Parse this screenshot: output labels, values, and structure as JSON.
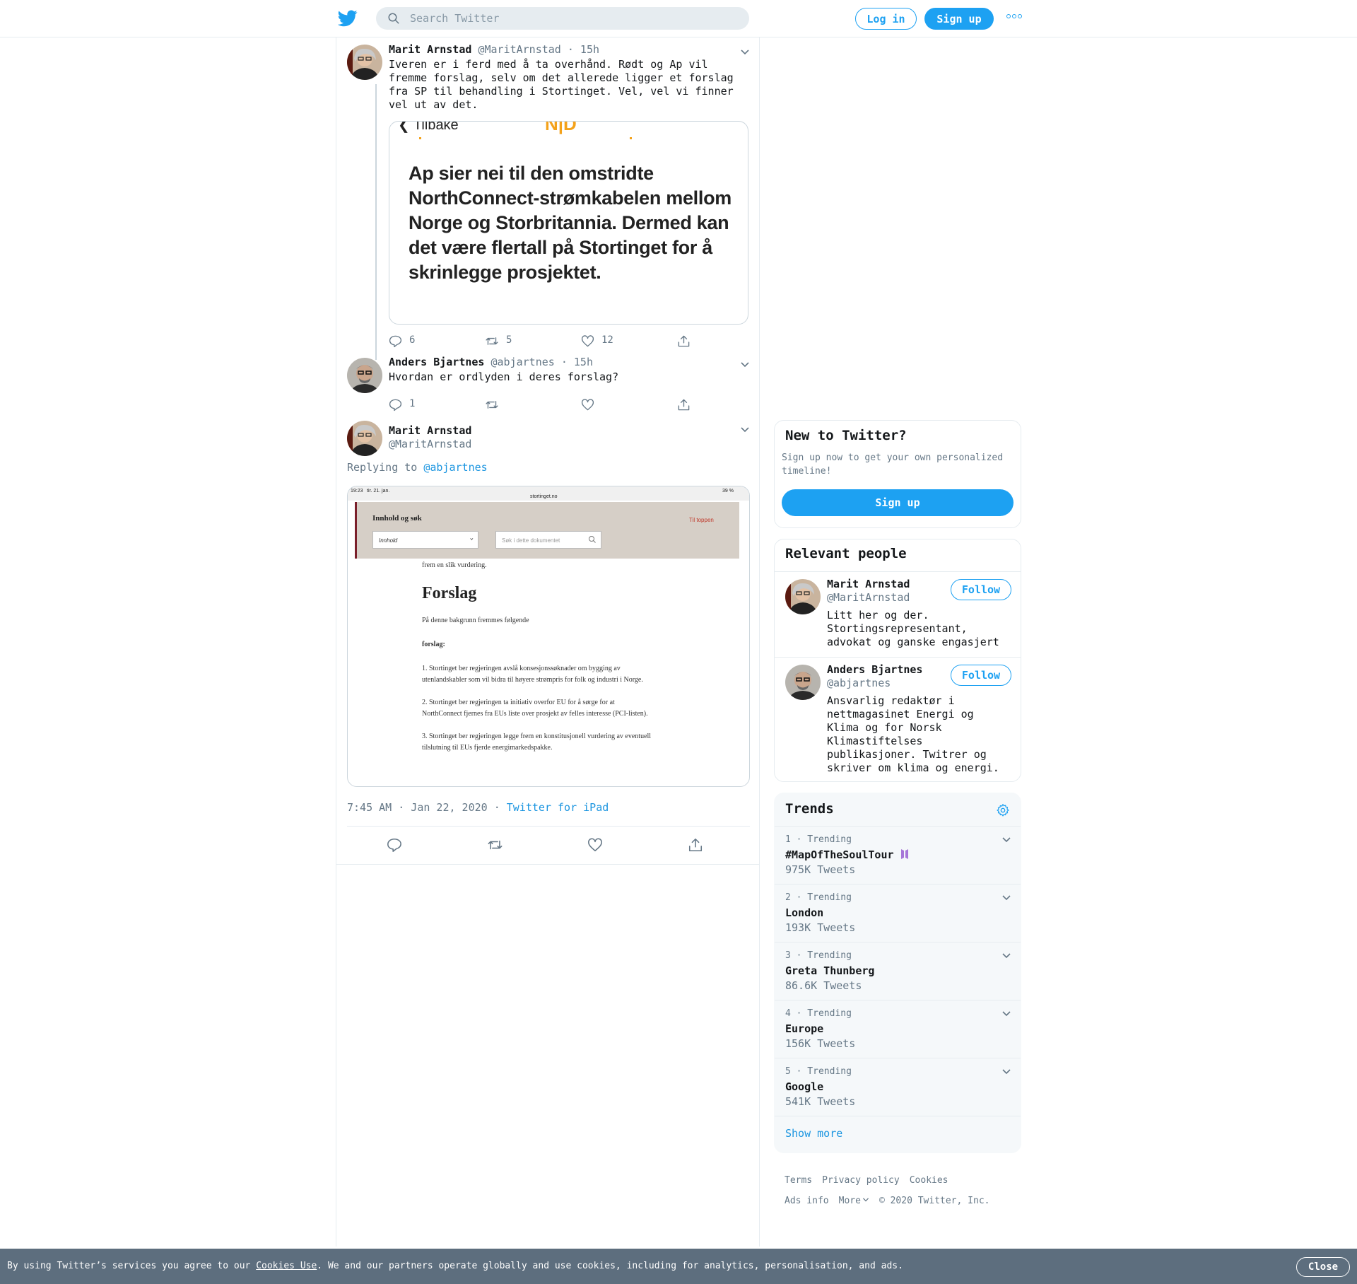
{
  "header": {
    "search_placeholder": "Search Twitter",
    "login_label": "Log in",
    "signup_label": "Sign up"
  },
  "thread": [
    {
      "name": "Marit Arnstad",
      "handle": "@MaritArnstad",
      "time": "· 15h",
      "text": "Iveren er i ferd med å ta overhånd. Rødt og Ap vil fremme forslag, selv om det allerede ligger et forslag fra SP til behandling i Stortinget. Vel, vel vi finner vel ut av det.",
      "card": {
        "back_label": "Tilbake",
        "logo_text": "N|D",
        "headline": "Ap sier nei til den omstridte NorthConnect-strømkabelen mellom Norge og Storbritannia. Dermed kan det være flertall på Stortinget for å skrinlegge prosjektet."
      },
      "replies": "6",
      "retweets": "5",
      "likes": "12"
    },
    {
      "name": "Anders Bjartnes",
      "handle": "@abjartnes",
      "time": "· 15h",
      "text": "Hvordan er ordlyden i deres forslag?",
      "replies": "1",
      "retweets": "",
      "likes": ""
    }
  ],
  "focus_tweet": {
    "name": "Marit Arnstad",
    "handle": "@MaritArnstad",
    "replying_prefix": "Replying to",
    "replying_to": "@abjartnes",
    "timestamp": "7:45 AM · Jan 22, 2020",
    "separator": "·",
    "source": "Twitter for iPad",
    "screenshot": {
      "status_time": "19:23",
      "status_date": "tir. 21. jan.",
      "url": "stortinget.no",
      "battery": "39 %",
      "panel_title": "Innhold og søk",
      "to_top": "Til toppen",
      "select_value": "Innhold",
      "search_placeholder": "Søk i dette dokumentet",
      "intro_line": "frem en slik vurdering.",
      "heading": "Forslag",
      "lead": "På denne bakgrunn fremmes følgende",
      "sub": "forslag:",
      "items": [
        "1. Stortinget ber regjeringen avslå konsesjonssøknader om bygging av",
        "utenlandskabler som vil bidra til høyere strømpris for folk og industri i Norge.",
        "2. Stortinget ber regjeringen ta initiativ overfor EU for å sørge for at",
        "NorthConnect fjernes fra EUs liste over prosjekt av felles interesse (PCI-listen).",
        "3. Stortinget ber regjeringen legge frem en konstitusjonell vurdering av eventuell",
        "tilslutning til EUs fjerde energimarkedspakke."
      ]
    }
  },
  "sidebar": {
    "new_title": "New to Twitter?",
    "new_text": "Sign up now to get your own personalized timeline!",
    "new_signup": "Sign up",
    "relevant_title": "Relevant people",
    "people": [
      {
        "name": "Marit Arnstad",
        "handle": "@MaritArnstad",
        "bio": "Litt her og der. Stortingsrepresentant, advokat og ganske engasjert",
        "follow": "Follow"
      },
      {
        "name": "Anders Bjartnes",
        "handle": "@abjartnes",
        "bio": "Ansvarlig redaktør i nettmagasinet Energi og Klima og for Norsk Klimastiftelses publikasjoner. Twitrer og skriver om klima og energi.",
        "follow": "Follow"
      }
    ],
    "trends_title": "Trends",
    "trends": [
      {
        "meta": "1 · Trending",
        "name": "#MapOfTheSoulTour",
        "count": "975K Tweets"
      },
      {
        "meta": "2 · Trending",
        "name": "London",
        "count": "193K Tweets"
      },
      {
        "meta": "3 · Trending",
        "name": "Greta Thunberg",
        "count": "86.6K Tweets"
      },
      {
        "meta": "4 · Trending",
        "name": "Europe",
        "count": "156K Tweets"
      },
      {
        "meta": "5 · Trending",
        "name": "Google",
        "count": "541K Tweets"
      }
    ],
    "show_more": "Show more"
  },
  "footer": {
    "terms": "Terms",
    "privacy": "Privacy policy",
    "cookies": "Cookies",
    "ads": "Ads info",
    "more": "More",
    "copyright": "© 2020 Twitter, Inc."
  },
  "cookie_bar": {
    "prefix": "By using Twitter’s services you agree to our ",
    "link": "Cookies Use",
    "suffix": ". We and our partners operate globally and use cookies, including for analytics, personalisation, and ads.",
    "close": "Close"
  },
  "colors": {
    "accent": "#1da1f2",
    "link": "#1b95e0",
    "secondary_text": "#657786",
    "border": "#e6ecf0",
    "cookie_bar": "#5d6e7e"
  }
}
